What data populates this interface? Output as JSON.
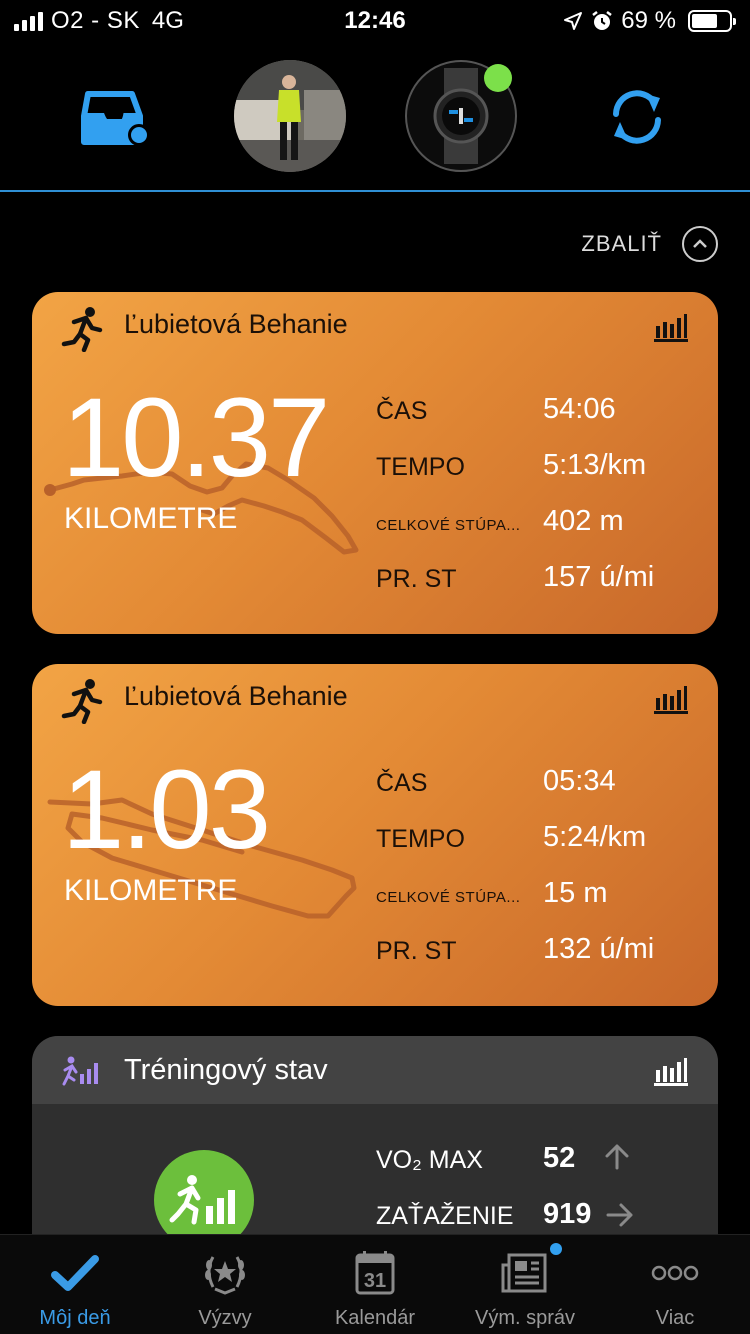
{
  "status_bar": {
    "carrier": "O2 - SK",
    "network": "4G",
    "time": "12:46",
    "battery_text": "69 %",
    "battery_level": 0.69
  },
  "top_nav": {
    "inbox_icon": "inbox-icon",
    "sync_icon": "sync-icon",
    "accent_color": "#32a0f0",
    "device_status_color": "#7ce04a"
  },
  "collapse_label": "ZBALIŤ",
  "activities": [
    {
      "title": "Ľubietová Behanie",
      "distance": "10.37",
      "unit": "KILOMETRE",
      "stats": [
        {
          "label": "ČAS",
          "value": "54:06"
        },
        {
          "label": "TEMPO",
          "value": "5:13/km"
        },
        {
          "label": "CELKOVÉ STÚPA...",
          "value": "402 m"
        },
        {
          "label": "PR. ST",
          "value": "157 ú/mi"
        }
      ]
    },
    {
      "title": "Ľubietová Behanie",
      "distance": "1.03",
      "unit": "KILOMETRE",
      "stats": [
        {
          "label": "ČAS",
          "value": "05:34"
        },
        {
          "label": "TEMPO",
          "value": "5:24/km"
        },
        {
          "label": "CELKOVÉ STÚPA...",
          "value": "15 m"
        },
        {
          "label": "PR. ST",
          "value": "132 ú/mi"
        }
      ]
    }
  ],
  "training": {
    "title": "Tréningový stav",
    "metrics": [
      {
        "label": "VO₂ MAX",
        "value": "52",
        "trend_icon": "arrow-up-icon"
      },
      {
        "label": "ZAŤAŽENIE",
        "value": "919",
        "trend_icon": "arrow-right-icon"
      }
    ],
    "status_color": "#6cbf3c"
  },
  "tabs": [
    {
      "label": "Môj deň",
      "icon": "checkmark-icon",
      "active": true
    },
    {
      "label": "Výzvy",
      "icon": "laurel-icon",
      "active": false
    },
    {
      "label": "Kalendár",
      "icon": "calendar-icon",
      "calendar_day": "31",
      "active": false
    },
    {
      "label": "Vým. správ",
      "icon": "newsfeed-icon",
      "active": false
    },
    {
      "label": "Viac",
      "icon": "more-icon",
      "active": false
    }
  ]
}
